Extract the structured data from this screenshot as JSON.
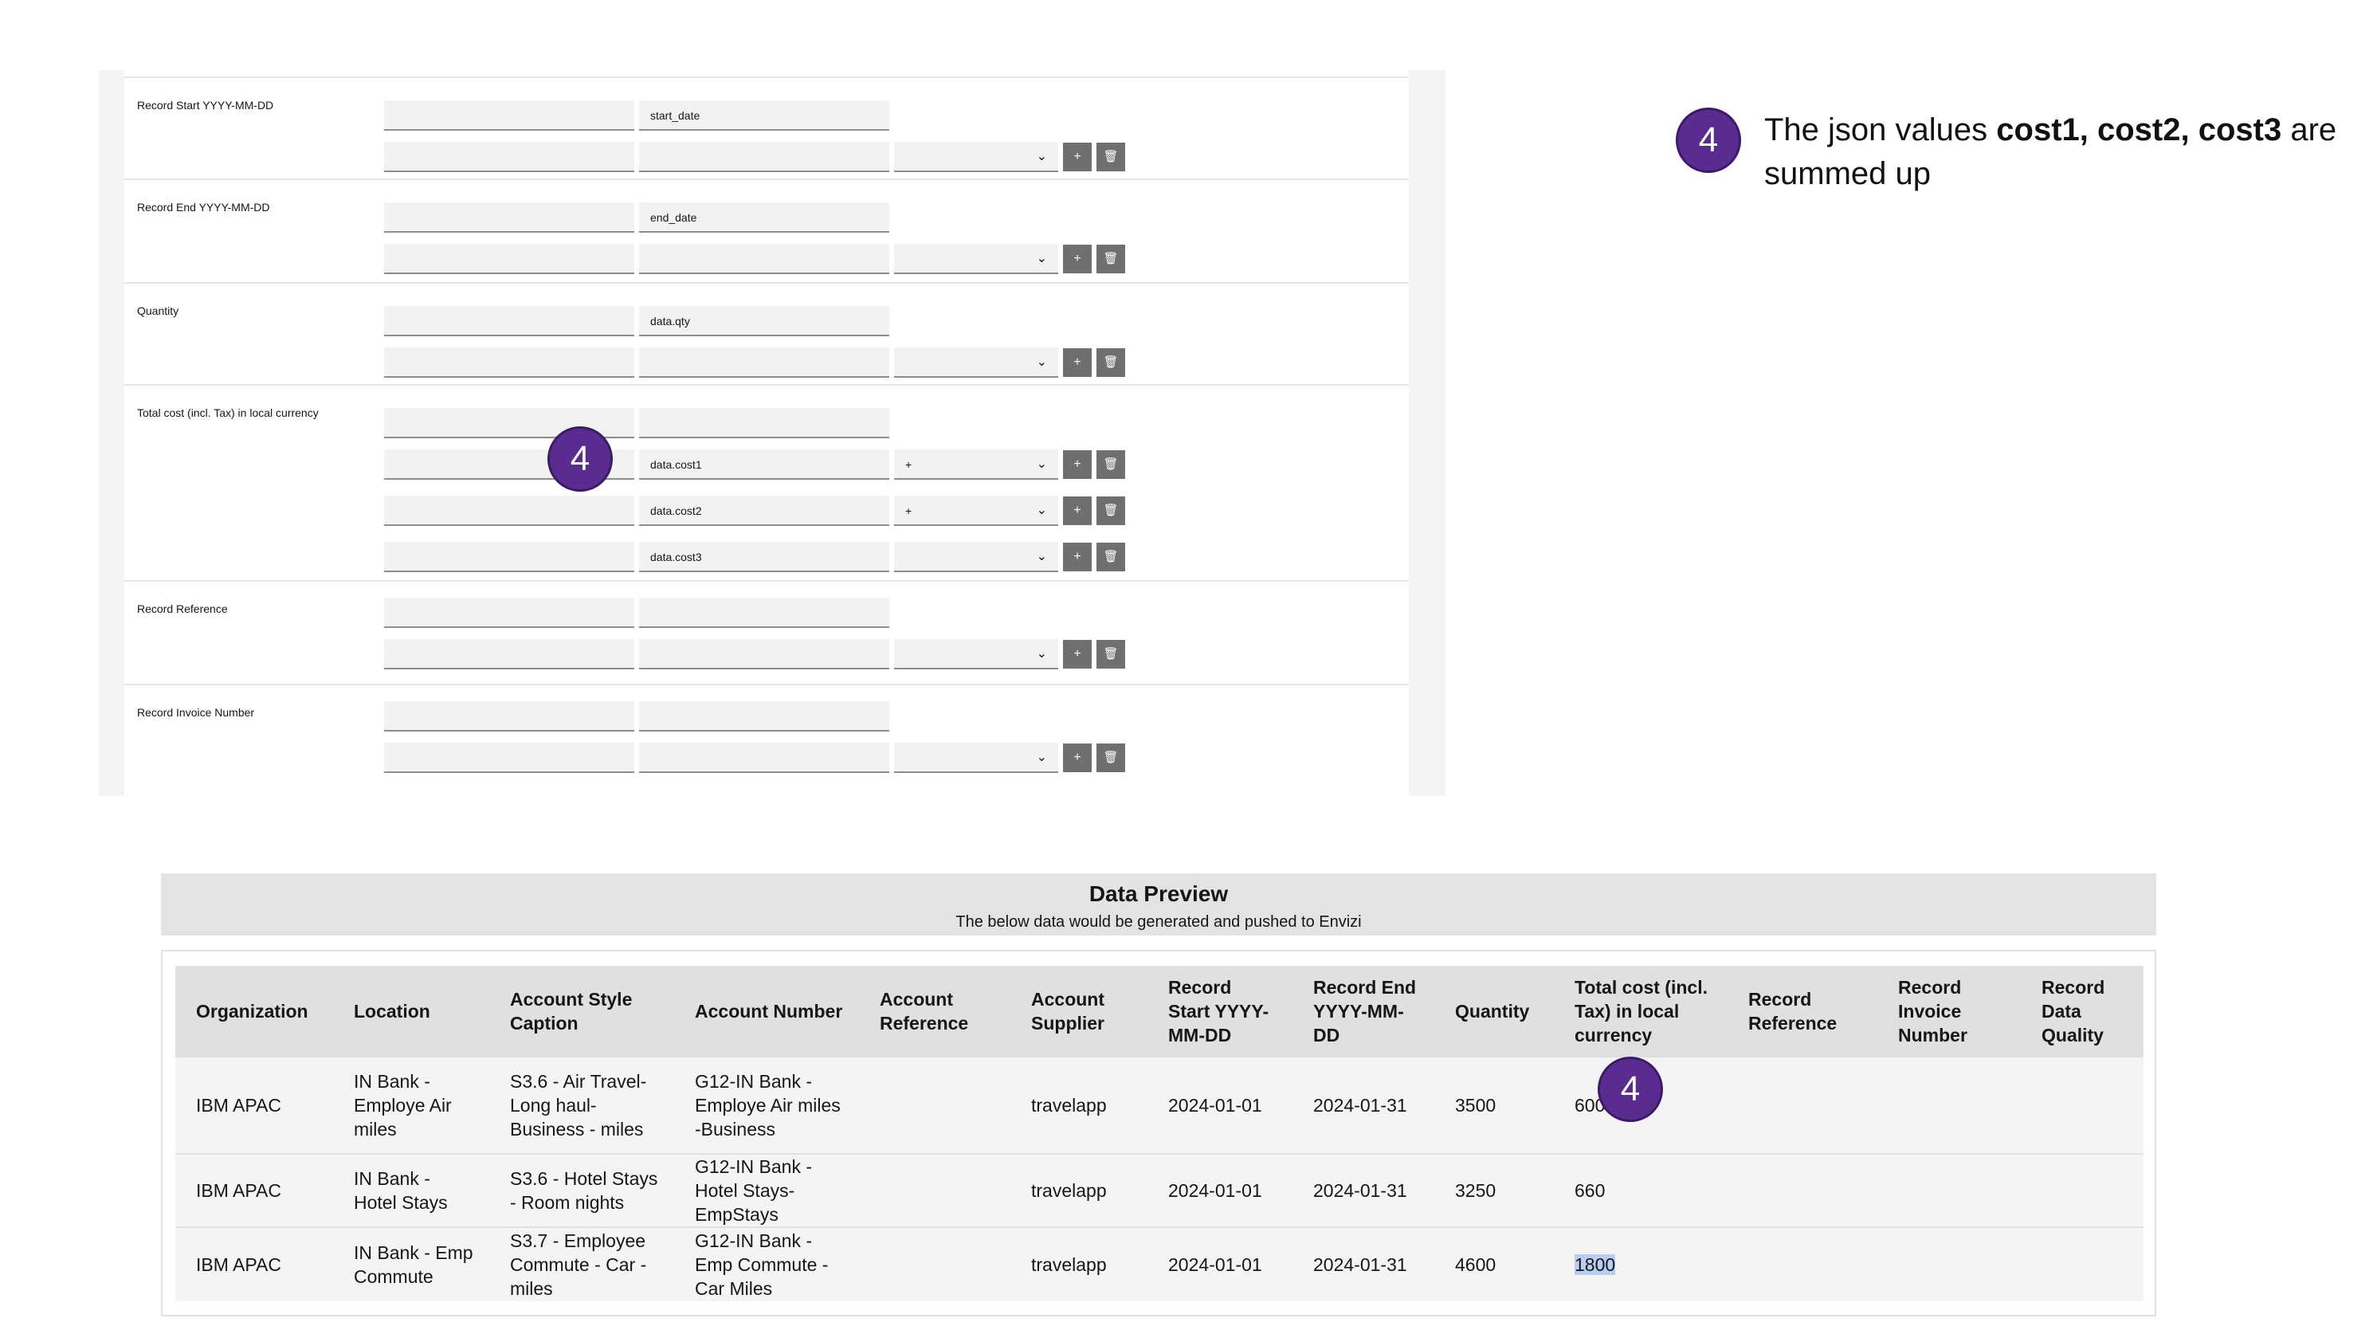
{
  "form": {
    "rows": [
      {
        "label": "Record Start YYYY-MM-DD",
        "top_value": "start_date",
        "selects": [
          ""
        ]
      },
      {
        "label": "Record End YYYY-MM-DD",
        "top_value": "end_date",
        "selects": [
          ""
        ]
      },
      {
        "label": "Quantity",
        "top_value": "data.qty",
        "selects": [
          ""
        ]
      },
      {
        "label": "Total cost (incl. Tax) in local currency",
        "top_value": "",
        "lines": [
          {
            "value": "data.cost1",
            "select": "+"
          },
          {
            "value": "data.cost2",
            "select": "+"
          },
          {
            "value": "data.cost3",
            "select": ""
          }
        ]
      },
      {
        "label": "Record Reference",
        "top_value": ""
      },
      {
        "label": "Record Invoice Number",
        "top_value": ""
      }
    ],
    "add_symbol": "+",
    "badge_number": "4"
  },
  "annotation": {
    "badge_number": "4",
    "text_prefix": "The json values ",
    "text_bold": "cost1, cost2, cost3",
    "text_suffix": " are summed up"
  },
  "preview": {
    "title": "Data Preview",
    "subtitle": "The below data would be generated and pushed to Envizi",
    "columns": [
      "Organization",
      "Location",
      "Account Style Caption",
      "Account Number",
      "Account Reference",
      "Account Supplier",
      "Record Start YYYY-MM-DD",
      "Record End YYYY-MM-DD",
      "Quantity",
      "Total cost (incl. Tax) in local currency",
      "Record Reference",
      "Record Invoice Number",
      "Record Data Quality"
    ],
    "rows": [
      [
        "IBM APAC",
        "IN Bank - Employe Air miles",
        "S3.6 - Air Travel-Long haul-Business - miles",
        "G12-IN Bank - Employe Air miles -Business",
        "",
        "travelapp",
        "2024-01-01",
        "2024-01-31",
        "3500",
        "600",
        "",
        "",
        ""
      ],
      [
        "IBM APAC",
        "IN Bank - Hotel Stays",
        "S3.6 - Hotel Stays - Room nights",
        "G12-IN Bank - Hotel Stays-EmpStays",
        "",
        "travelapp",
        "2024-01-01",
        "2024-01-31",
        "3250",
        "660",
        "",
        "",
        ""
      ],
      [
        "IBM APAC",
        "IN Bank - Emp Commute",
        "S3.7 - Employee Commute - Car - miles",
        "G12-IN Bank - Emp Commute - Car Miles",
        "",
        "travelapp",
        "2024-01-01",
        "2024-01-31",
        "4600",
        "1800",
        "",
        "",
        ""
      ]
    ],
    "badge_number": "4"
  }
}
